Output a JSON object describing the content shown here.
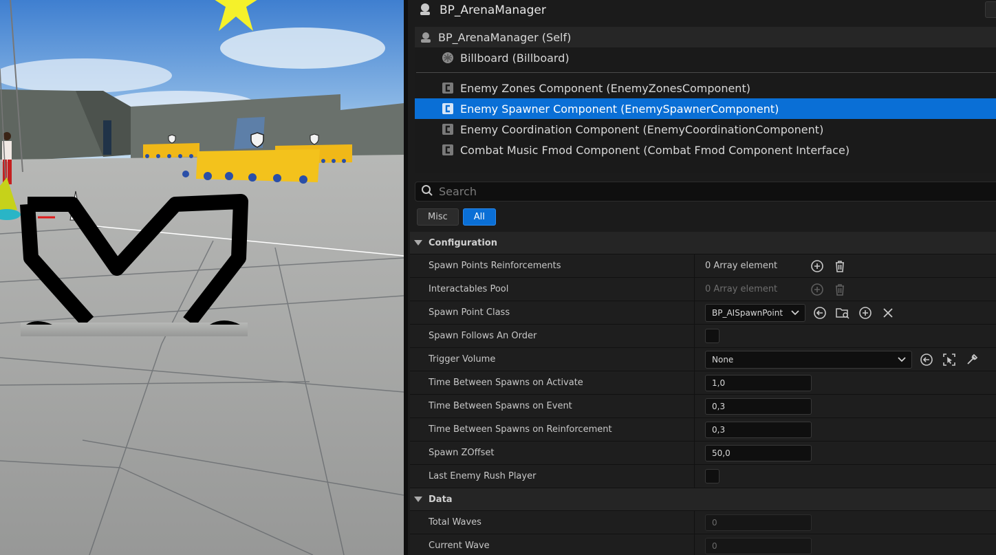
{
  "header": {
    "title": "BP_ArenaManager"
  },
  "components": {
    "self": "BP_ArenaManager (Self)",
    "items": [
      {
        "label": "Billboard (Billboard)"
      },
      {
        "label": "Enemy Zones Component (EnemyZonesComponent)"
      },
      {
        "label": "Enemy Spawner Component (EnemySpawnerComponent)",
        "selected": true
      },
      {
        "label": "Enemy Coordination Component (EnemyCoordinationComponent)"
      },
      {
        "label": "Combat Music Fmod Component (Combat Fmod Component Interface)"
      }
    ]
  },
  "search": {
    "placeholder": "Search"
  },
  "filters": {
    "misc": "Misc",
    "all": "All"
  },
  "categories": {
    "configuration": {
      "label": "Configuration",
      "props": {
        "spawn_points_reinforcements": {
          "name": "Spawn Points Reinforcements",
          "value": "0 Array element"
        },
        "interactables_pool": {
          "name": "Interactables Pool",
          "value": "0 Array element"
        },
        "spawn_point_class": {
          "name": "Spawn Point Class",
          "value": "BP_AISpawnPoint"
        },
        "spawn_follows_an_order": {
          "name": "Spawn Follows An Order"
        },
        "trigger_volume": {
          "name": "Trigger Volume",
          "value": "None"
        },
        "time_on_activate": {
          "name": "Time Between Spawns on Activate",
          "value": "1,0"
        },
        "time_on_event": {
          "name": "Time Between Spawns on Event",
          "value": "0,3"
        },
        "time_on_reinforcement": {
          "name": "Time Between Spawns on Reinforcement",
          "value": "0,3"
        },
        "spawn_zoffset": {
          "name": "Spawn ZOffset",
          "value": "50,0"
        },
        "last_enemy_rush_player": {
          "name": "Last Enemy Rush Player"
        }
      }
    },
    "data": {
      "label": "Data",
      "props": {
        "total_waves": {
          "name": "Total Waves",
          "value": "0"
        },
        "current_wave": {
          "name": "Current Wave",
          "value": "0"
        }
      }
    }
  },
  "colors": {
    "selection": "#0a6fd6",
    "panel_bg": "#1b1b1b"
  }
}
